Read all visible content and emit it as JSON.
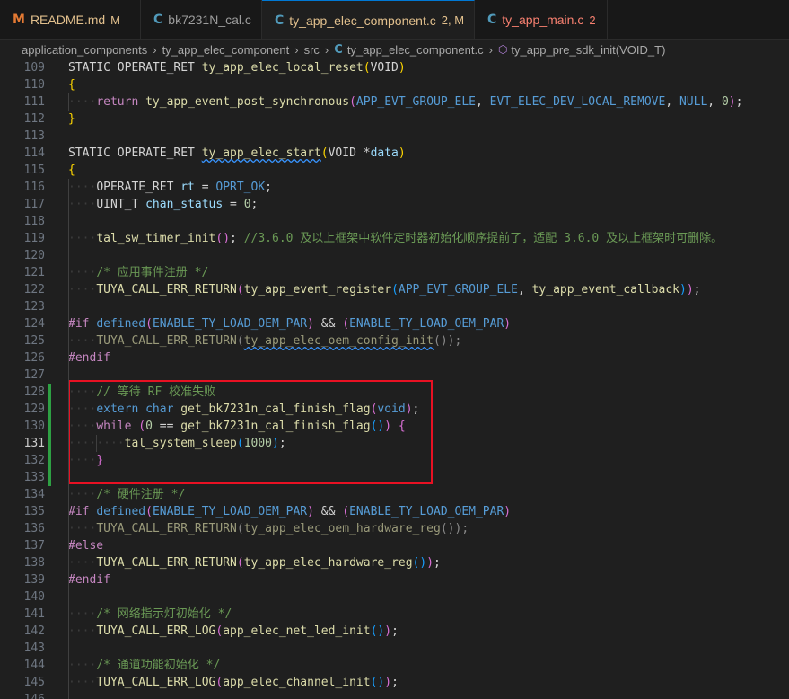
{
  "tabs": [
    {
      "icon": "M",
      "icon_color": "#e37933",
      "name": "README.md",
      "badge": "M",
      "badge_kind": "m",
      "active": false,
      "modified": true
    },
    {
      "icon": "C",
      "icon_color": "#519aba",
      "name": "bk7231N_cal.c",
      "badge": "",
      "badge_kind": "",
      "active": false,
      "modified": false
    },
    {
      "icon": "C",
      "icon_color": "#519aba",
      "name": "ty_app_elec_component.c",
      "badge": "2, M",
      "badge_kind": "m",
      "active": true,
      "modified": true,
      "close": "×"
    },
    {
      "icon": "C",
      "icon_color": "#519aba",
      "name": "ty_app_main.c",
      "badge": "2",
      "badge_kind": "err",
      "active": false,
      "modified": false,
      "error": true
    }
  ],
  "breadcrumb": {
    "parts": [
      "application_components",
      "ty_app_elec_component",
      "src",
      "ty_app_elec_component.c",
      "ty_app_pre_sdk_init(VOID_T)"
    ],
    "separator": "›"
  },
  "editor": {
    "current_line": 131,
    "lines": [
      {
        "n": 109,
        "ind": 0,
        "t": [
          [
            "STATIC OPERATE_RET ",
            "pl"
          ],
          [
            "ty_app_elec_local_reset",
            "fn"
          ],
          [
            "(",
            "br"
          ],
          [
            "VOID",
            "pl"
          ],
          [
            ")",
            "br"
          ]
        ]
      },
      {
        "n": 110,
        "ind": 0,
        "t": [
          [
            "{",
            "br"
          ]
        ]
      },
      {
        "n": 111,
        "ind": 1,
        "t": [
          [
            "return ",
            "ctl"
          ],
          [
            "ty_app_event_post_synchronous",
            "fn"
          ],
          [
            "(",
            "br2"
          ],
          [
            "APP_EVT_GROUP_ELE",
            "mac"
          ],
          [
            ", ",
            "pl"
          ],
          [
            "EVT_ELEC_DEV_LOCAL_REMOVE",
            "mac"
          ],
          [
            ", ",
            "pl"
          ],
          [
            "NULL",
            "mac"
          ],
          [
            ", ",
            "pl"
          ],
          [
            "0",
            "num"
          ],
          [
            ")",
            "br2"
          ],
          [
            ";",
            "pl"
          ]
        ]
      },
      {
        "n": 112,
        "ind": 0,
        "t": [
          [
            "}",
            "br"
          ]
        ]
      },
      {
        "n": 113,
        "ind": 0,
        "t": []
      },
      {
        "n": 114,
        "ind": 0,
        "t": [
          [
            "STATIC OPERATE_RET ",
            "pl"
          ],
          [
            "ty_app_elec_start",
            "fn",
            "squig"
          ],
          [
            "(",
            "br"
          ],
          [
            "VOID *",
            "pl"
          ],
          [
            "data",
            "var"
          ],
          [
            ")",
            "br"
          ]
        ]
      },
      {
        "n": 115,
        "ind": 0,
        "t": [
          [
            "{",
            "br"
          ]
        ]
      },
      {
        "n": 116,
        "ind": 1,
        "t": [
          [
            "OPERATE_RET ",
            "pl"
          ],
          [
            "rt",
            "var"
          ],
          [
            " = ",
            "pl"
          ],
          [
            "OPRT_OK",
            "mac"
          ],
          [
            ";",
            "pl"
          ]
        ]
      },
      {
        "n": 117,
        "ind": 1,
        "t": [
          [
            "UINT_T ",
            "pl"
          ],
          [
            "chan_status",
            "var"
          ],
          [
            " = ",
            "pl"
          ],
          [
            "0",
            "num"
          ],
          [
            ";",
            "pl"
          ]
        ]
      },
      {
        "n": 118,
        "ind": 0,
        "t": []
      },
      {
        "n": 119,
        "ind": 1,
        "t": [
          [
            "tal_sw_timer_init",
            "fn"
          ],
          [
            "()",
            "br2"
          ],
          [
            "; ",
            "pl"
          ],
          [
            "//3.6.0 及以上框架中软件定时器初始化顺序提前了，适配 3.6.0 及以上框架时可删除。",
            "com"
          ]
        ]
      },
      {
        "n": 120,
        "ind": 0,
        "t": []
      },
      {
        "n": 121,
        "ind": 1,
        "t": [
          [
            "/* 应用事件注册 */",
            "com"
          ]
        ]
      },
      {
        "n": 122,
        "ind": 1,
        "t": [
          [
            "TUYA_CALL_ERR_RETURN",
            "fn"
          ],
          [
            "(",
            "br2"
          ],
          [
            "ty_app_event_register",
            "fn"
          ],
          [
            "(",
            "br3"
          ],
          [
            "APP_EVT_GROUP_ELE",
            "mac"
          ],
          [
            ", ",
            "pl"
          ],
          [
            "ty_app_event_callback",
            "fn"
          ],
          [
            ")",
            "br3"
          ],
          [
            ")",
            "br2"
          ],
          [
            ";",
            "pl"
          ]
        ]
      },
      {
        "n": 123,
        "ind": 0,
        "t": []
      },
      {
        "n": 124,
        "ind": 0,
        "t": [
          [
            "#if ",
            "ctl"
          ],
          [
            "defined",
            "mac"
          ],
          [
            "(",
            "br2"
          ],
          [
            "ENABLE_TY_LOAD_OEM_PAR",
            "mac"
          ],
          [
            ")",
            "br2"
          ],
          [
            " && ",
            "pl"
          ],
          [
            "(",
            "br2"
          ],
          [
            "ENABLE_TY_LOAD_OEM_PAR",
            "mac"
          ],
          [
            ")",
            "br2"
          ]
        ]
      },
      {
        "n": 125,
        "ind": 1,
        "t": [
          [
            "TUYA_CALL_ERR_RETURN",
            "dimfn"
          ],
          [
            "(",
            "dim"
          ],
          [
            "ty_app_elec_oem_config_init",
            "dimfn",
            "squig"
          ],
          [
            "()",
            "dim"
          ],
          [
            ");",
            "dim"
          ]
        ]
      },
      {
        "n": 126,
        "ind": 0,
        "t": [
          [
            "#endif",
            "ctl"
          ]
        ]
      },
      {
        "n": 127,
        "ind": 0,
        "t": []
      },
      {
        "n": 128,
        "ind": 1,
        "t": [
          [
            "// 等待 RF 校准失败",
            "com"
          ]
        ]
      },
      {
        "n": 129,
        "ind": 1,
        "t": [
          [
            "extern ",
            "kw"
          ],
          [
            "char ",
            "kw"
          ],
          [
            "get_bk7231n_cal_finish_flag",
            "fn"
          ],
          [
            "(",
            "br2"
          ],
          [
            "void",
            "kw"
          ],
          [
            ")",
            "br2"
          ],
          [
            ";",
            "pl"
          ]
        ]
      },
      {
        "n": 130,
        "ind": 1,
        "t": [
          [
            "while ",
            "ctl"
          ],
          [
            "(",
            "br2"
          ],
          [
            "0",
            "num"
          ],
          [
            " == ",
            "pl"
          ],
          [
            "get_bk7231n_cal_finish_flag",
            "fn"
          ],
          [
            "()",
            "br3"
          ],
          [
            ")",
            "br2"
          ],
          [
            " {",
            "br2"
          ]
        ]
      },
      {
        "n": 131,
        "ind": 2,
        "t": [
          [
            "tal_system_sleep",
            "fn"
          ],
          [
            "(",
            "br3"
          ],
          [
            "1000",
            "num"
          ],
          [
            ")",
            "br3"
          ],
          [
            ";",
            "pl"
          ]
        ]
      },
      {
        "n": 132,
        "ind": 1,
        "t": [
          [
            "}",
            "br2"
          ]
        ]
      },
      {
        "n": 133,
        "ind": 0,
        "t": []
      },
      {
        "n": 134,
        "ind": 1,
        "t": [
          [
            "/* 硬件注册 */",
            "com"
          ]
        ]
      },
      {
        "n": 135,
        "ind": 0,
        "t": [
          [
            "#if ",
            "ctl"
          ],
          [
            "defined",
            "mac"
          ],
          [
            "(",
            "br2"
          ],
          [
            "ENABLE_TY_LOAD_OEM_PAR",
            "mac"
          ],
          [
            ")",
            "br2"
          ],
          [
            " && ",
            "pl"
          ],
          [
            "(",
            "br2"
          ],
          [
            "ENABLE_TY_LOAD_OEM_PAR",
            "mac"
          ],
          [
            ")",
            "br2"
          ]
        ]
      },
      {
        "n": 136,
        "ind": 1,
        "t": [
          [
            "TUYA_CALL_ERR_RETURN",
            "dimfn"
          ],
          [
            "(",
            "dim"
          ],
          [
            "ty_app_elec_oem_hardware_reg",
            "dimfn"
          ],
          [
            "()",
            "dim"
          ],
          [
            ");",
            "dim"
          ]
        ]
      },
      {
        "n": 137,
        "ind": 0,
        "t": [
          [
            "#else",
            "ctl"
          ]
        ]
      },
      {
        "n": 138,
        "ind": 1,
        "t": [
          [
            "TUYA_CALL_ERR_RETURN",
            "fn"
          ],
          [
            "(",
            "br2"
          ],
          [
            "ty_app_elec_hardware_reg",
            "fn"
          ],
          [
            "()",
            "br3"
          ],
          [
            ")",
            "br2"
          ],
          [
            ";",
            "pl"
          ]
        ]
      },
      {
        "n": 139,
        "ind": 0,
        "t": [
          [
            "#endif",
            "ctl"
          ]
        ]
      },
      {
        "n": 140,
        "ind": 0,
        "t": []
      },
      {
        "n": 141,
        "ind": 1,
        "t": [
          [
            "/* 网络指示灯初始化 */",
            "com"
          ]
        ]
      },
      {
        "n": 142,
        "ind": 1,
        "t": [
          [
            "TUYA_CALL_ERR_LOG",
            "fn"
          ],
          [
            "(",
            "br2"
          ],
          [
            "app_elec_net_led_init",
            "fn"
          ],
          [
            "()",
            "br3"
          ],
          [
            ")",
            "br2"
          ],
          [
            ";",
            "pl"
          ]
        ]
      },
      {
        "n": 143,
        "ind": 0,
        "t": []
      },
      {
        "n": 144,
        "ind": 1,
        "t": [
          [
            "/* 通道功能初始化 */",
            "com"
          ]
        ]
      },
      {
        "n": 145,
        "ind": 1,
        "t": [
          [
            "TUYA_CALL_ERR_LOG",
            "fn"
          ],
          [
            "(",
            "br2"
          ],
          [
            "app_elec_channel_init",
            "fn"
          ],
          [
            "()",
            "br3"
          ],
          [
            ")",
            "br2"
          ],
          [
            ";",
            "pl"
          ]
        ]
      },
      {
        "n": 146,
        "ind": 0,
        "t": []
      }
    ]
  },
  "colors": {
    "highlight_box": "#e81123",
    "change_bar": "#2ea043",
    "active_tab_border": "#0078d4"
  }
}
